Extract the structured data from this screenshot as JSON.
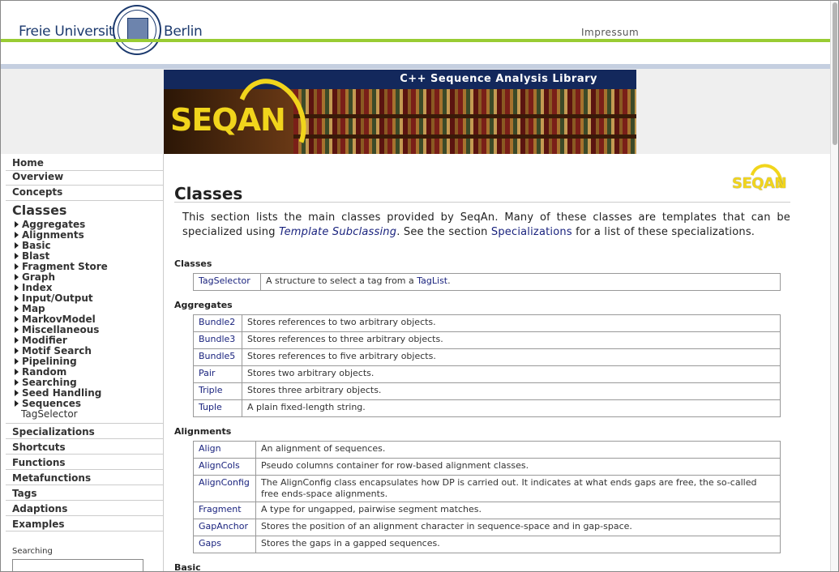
{
  "header": {
    "fu_left": "Freie Universität",
    "fu_right": "Berlin",
    "impressum": "Impressum"
  },
  "banner": {
    "title": "C++ Sequence Analysis Library",
    "logo_text": "SEQAN"
  },
  "sidebar": {
    "top_items": [
      "Home",
      "Overview",
      "Concepts"
    ],
    "classes_heading": "Classes",
    "class_items": [
      "Aggregates",
      "Alignments",
      "Basic",
      "Blast",
      "Fragment Store",
      "Graph",
      "Index",
      "Input/Output",
      "Map",
      "MarkovModel",
      "Miscellaneous",
      "Modifier",
      "Motif Search",
      "Pipelining",
      "Random",
      "Searching",
      "Seed Handling",
      "Sequences"
    ],
    "plain_item": "TagSelector",
    "bottom_items": [
      "Specializations",
      "Shortcuts",
      "Functions",
      "Metafunctions",
      "Tags",
      "Adaptions",
      "Examples"
    ],
    "search_label": "Searching"
  },
  "main": {
    "title": "Classes",
    "logo_text": "SEQAN",
    "intro": {
      "p1": "This section lists the main classes provided by SeqAn. Many of these classes are templates that can be specialized using ",
      "link1": "Template Subclassing",
      "p2": ". See the section ",
      "link2": "Specializations",
      "p3": " for a list of these specializations."
    },
    "sections": [
      {
        "heading": "Classes",
        "rows": [
          {
            "name": "TagSelector",
            "desc_pre": "A structure to select a tag from a ",
            "desc_link": "TagList",
            "desc_post": "."
          }
        ]
      },
      {
        "heading": "Aggregates",
        "rows": [
          {
            "name": "Bundle2",
            "desc": "Stores references to two arbitrary objects."
          },
          {
            "name": "Bundle3",
            "desc": "Stores references to three arbitrary objects."
          },
          {
            "name": "Bundle5",
            "desc": "Stores references to five arbitrary objects."
          },
          {
            "name": "Pair",
            "desc": "Stores two arbitrary objects."
          },
          {
            "name": "Triple",
            "desc": "Stores three arbitrary objects."
          },
          {
            "name": "Tuple",
            "desc": "A plain fixed-length string."
          }
        ]
      },
      {
        "heading": "Alignments",
        "rows": [
          {
            "name": "Align",
            "desc": "An alignment of sequences."
          },
          {
            "name": "AlignCols",
            "desc": "Pseudo columns container for row-based alignment classes."
          },
          {
            "name": "AlignConfig",
            "desc": "The AlignConfig class encapsulates how DP is carried out. It indicates at what ends gaps are free, the so-called free ends-space alignments."
          },
          {
            "name": "Fragment",
            "desc": "A type for ungapped, pairwise segment matches."
          },
          {
            "name": "GapAnchor",
            "desc": "Stores the position of an alignment character in sequence-space and in gap-space."
          },
          {
            "name": "Gaps",
            "desc": "Stores the gaps in a gapped sequences."
          }
        ]
      },
      {
        "heading": "Basic",
        "rows": []
      }
    ]
  },
  "colors": {
    "accent_green": "#99cc33",
    "link_blue": "#1a237e",
    "banner_navy": "#13285c",
    "logo_yellow": "#f1d51c"
  }
}
